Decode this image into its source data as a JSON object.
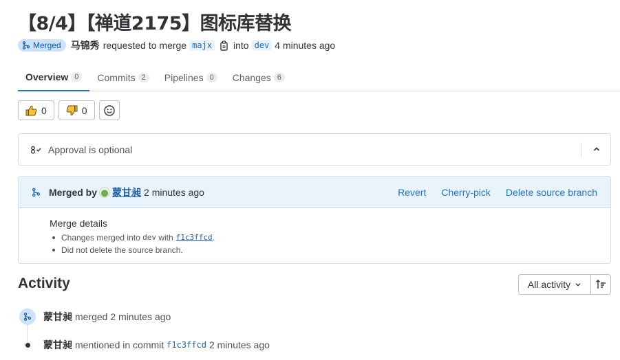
{
  "mr": {
    "title": "【8/4】【禅道2175】图标库替换",
    "status": "Merged",
    "author": "马锦秀",
    "requested_text": "requested to merge",
    "source_branch": "majx",
    "into_text": "into",
    "target_branch": "dev",
    "time_ago": "4 minutes ago"
  },
  "tabs": [
    {
      "label": "Overview",
      "count": "0"
    },
    {
      "label": "Commits",
      "count": "2"
    },
    {
      "label": "Pipelines",
      "count": "0"
    },
    {
      "label": "Changes",
      "count": "6"
    }
  ],
  "reactions": {
    "thumbs_up": "0",
    "thumbs_down": "0"
  },
  "approval": {
    "text": "Approval is optional"
  },
  "merged": {
    "by_label": "Merged by",
    "user": "蒙甘昶",
    "time": "2 minutes ago",
    "actions": {
      "revert": "Revert",
      "cherry_pick": "Cherry-pick",
      "delete_branch": "Delete source branch"
    },
    "details_title": "Merge details",
    "detail_1_prefix": "Changes merged into",
    "detail_1_branch": "dev",
    "detail_1_with": "with",
    "detail_1_sha": "f1c3ffcd",
    "detail_1_suffix": ".",
    "detail_2": "Did not delete the source branch."
  },
  "activity": {
    "title": "Activity",
    "filter": "All activity",
    "items": [
      {
        "user": "蒙甘昶",
        "action": "merged",
        "time": "2 minutes ago"
      },
      {
        "user": "蒙甘昶",
        "action": "mentioned in commit",
        "sha": "f1c3ffcd",
        "time": "2 minutes ago"
      }
    ]
  },
  "colors": {
    "accent": "#1f75cb",
    "merged_badge_bg": "#cbe2f9",
    "merged_badge_fg": "#0b5cad",
    "panel_header_bg": "#e9f3fc"
  },
  "icons": [
    "merge-icon",
    "copy-icon",
    "thumbs-up-icon",
    "thumbs-down-icon",
    "smiley-icon",
    "approval-icon",
    "chevron-up-icon",
    "chevron-down-icon",
    "sort-icon"
  ]
}
